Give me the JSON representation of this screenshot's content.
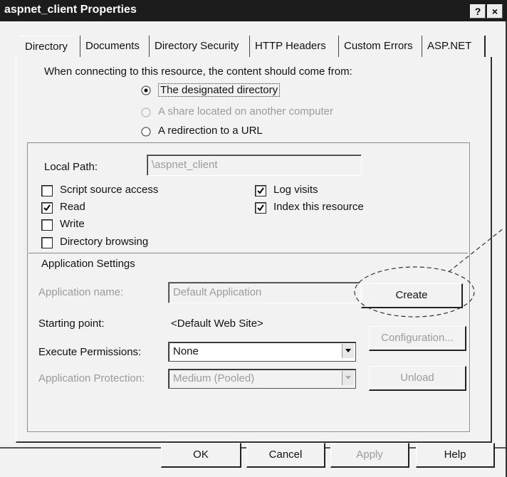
{
  "window": {
    "title": "aspnet_client Properties",
    "help_button": "?",
    "close_button": "×"
  },
  "tabs": [
    "Directory",
    "Documents",
    "Directory Security",
    "HTTP Headers",
    "Custom Errors",
    "ASP.NET"
  ],
  "content_source": {
    "heading": "When connecting to this resource, the content should come from:",
    "options": [
      {
        "label": "The designated directory",
        "selected": true,
        "enabled": true
      },
      {
        "label": "A share located on another computer",
        "selected": false,
        "enabled": false
      },
      {
        "label": "A redirection to a URL",
        "selected": false,
        "enabled": true
      }
    ]
  },
  "local_path": {
    "label": "Local Path:",
    "value": "\\aspnet_client"
  },
  "permissions_left": [
    {
      "label": "Script source access",
      "checked": false
    },
    {
      "label": "Read",
      "checked": true
    },
    {
      "label": "Write",
      "checked": false
    },
    {
      "label": "Directory browsing",
      "checked": false
    }
  ],
  "permissions_right": [
    {
      "label": "Log visits",
      "checked": true
    },
    {
      "label": "Index this resource",
      "checked": true
    }
  ],
  "app_settings": {
    "heading": "Application Settings",
    "app_name_label": "Application name:",
    "app_name_value": "Default Application",
    "starting_point_label": "Starting point:",
    "starting_point_value": "<Default Web Site>",
    "exec_perm_label": "Execute Permissions:",
    "exec_perm_value": "None",
    "protection_label": "Application Protection:",
    "protection_value": "Medium (Pooled)",
    "create_button": "Create",
    "config_button": "Configuration...",
    "unload_button": "Unload"
  },
  "footer_buttons": {
    "ok": "OK",
    "cancel": "Cancel",
    "apply": "Apply",
    "help": "Help"
  }
}
